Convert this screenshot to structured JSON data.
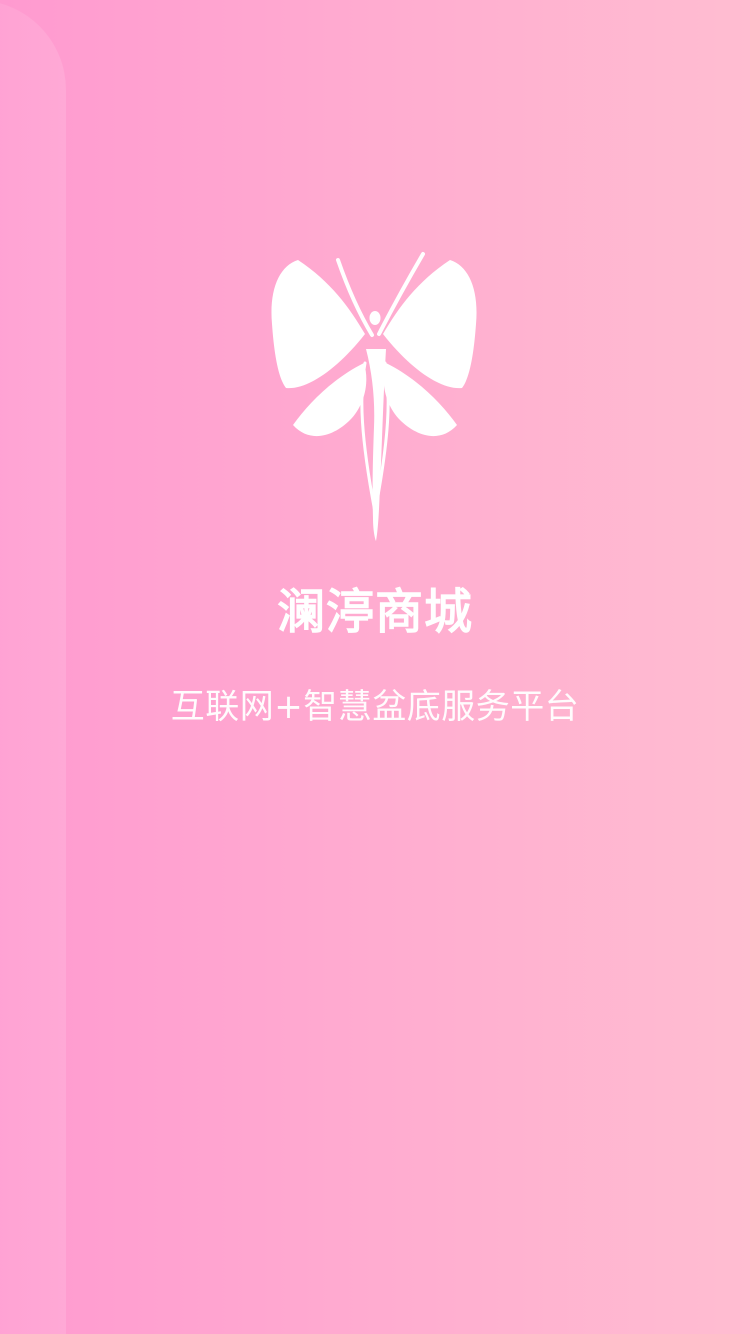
{
  "app": {
    "title": "澜渟商城",
    "subtitle": "互联网+智慧盆底服务平台",
    "logo_icon": "butterfly-icon"
  },
  "colors": {
    "background_left": "#ff9ad0",
    "background_mid": "#ffaad0",
    "background_right": "#ffbdd1",
    "foreground": "#ffffff"
  }
}
